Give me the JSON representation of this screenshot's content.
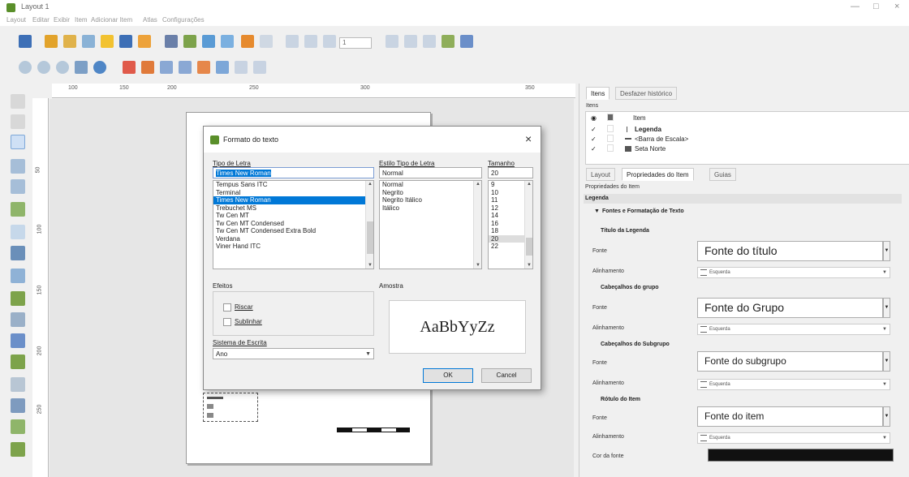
{
  "window": {
    "title": "Layout 1",
    "minimize": "—",
    "maximize": "□",
    "close": "×"
  },
  "menu": [
    "Layout",
    "Editar",
    "Exibir",
    "Item",
    "Adicionar Item",
    "Atlas",
    "Configurações"
  ],
  "ruler": {
    "top_ticks": [
      "100",
      "150",
      "200",
      "250",
      "300",
      "350"
    ],
    "left_ticks": [
      "50",
      "100",
      "150",
      "200",
      "250"
    ]
  },
  "toolbar": {
    "page_field_value": "1"
  },
  "dialog": {
    "title": "Formato do texto",
    "close": "×",
    "font_label": "Tipo de Letra",
    "font_value": "Times New Roman",
    "fonts": [
      "Tempus Sans ITC",
      "Terminal",
      "Times New Roman",
      "Trebuchet MS",
      "Tw Cen MT",
      "Tw Cen MT Condensed",
      "Tw Cen MT Condensed Extra Bold",
      "Verdana",
      "Viner Hand ITC"
    ],
    "selected_font_index": 2,
    "style_label": "Estilo Tipo de Letra",
    "style_value": "Normal",
    "styles": [
      "Normal",
      "Negrito",
      "Negrito Itálico",
      "Itálico"
    ],
    "size_label": "Tamanho",
    "size_value": "20",
    "sizes": [
      "9",
      "10",
      "11",
      "12",
      "14",
      "16",
      "18",
      "20",
      "22"
    ],
    "selected_size_index": 7,
    "effects_label": "Efeitos",
    "strike_label": "Riscar",
    "underline_label": "Sublinhar",
    "sample_label": "Amostra",
    "sample_text": "AaBbYyZz",
    "script_label": "Sistema de Escrita",
    "script_value": "Ano",
    "ok_label": "OK",
    "cancel_label": "Cancel"
  },
  "right_panel": {
    "top_tabs": [
      "Itens",
      "Desfazer histórico"
    ],
    "items_header": "Itens",
    "tree_header": "Item",
    "items": [
      {
        "check": "✓",
        "name": "Legenda",
        "icon": "legend-icon"
      },
      {
        "check": "✓",
        "name": "<Barra de Escala>",
        "icon": "scalebar-icon"
      },
      {
        "check": "✓",
        "name": "Seta Norte",
        "icon": "north-arrow-icon"
      }
    ],
    "prop_tabs": [
      "Layout",
      "Propriedades do Item",
      "Guias"
    ],
    "prop_header": "Propriedades do Item",
    "section": "Legenda",
    "group": "Fontes e Formatação de Texto",
    "blocks": [
      {
        "header": "Título da Legenda",
        "font_label": "Fonte",
        "font_button": "Fonte do título",
        "align_label": "Alinhamento",
        "align_value": "Esquerda"
      },
      {
        "header": "Cabeçalhos do grupo",
        "font_label": "Fonte",
        "font_button": "Fonte do Grupo",
        "align_label": "Alinhamento",
        "align_value": "Esquerda"
      },
      {
        "header": "Cabeçalhos do Subgrupo",
        "font_label": "Fonte",
        "font_button": "Fonte do subgrupo",
        "align_label": "Alinhamento",
        "align_value": "Esquerda"
      },
      {
        "header": "Rótulo do Item",
        "font_label": "Fonte",
        "font_button": "Fonte do item",
        "align_label": "Alinhamento",
        "align_value": "Esquerda"
      }
    ],
    "font_color_label": "Cor da fonte",
    "font_color": "#111111"
  },
  "colors": {
    "accent": "#0078d7",
    "qgis_green": "#5a8f2a"
  }
}
